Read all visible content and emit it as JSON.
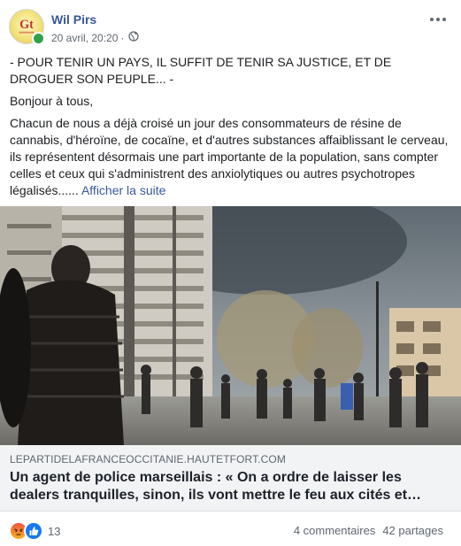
{
  "post": {
    "author": "Wil Pirs",
    "date": "20 avril, 20:20",
    "separator": "·",
    "privacy_icon": "globe-icon",
    "paragraphs": [
      "- POUR TENIR UN PAYS, IL SUFFIT DE TENIR SA JUSTICE, ET DE DROGUER SON PEUPLE... -",
      "Bonjour à tous,"
    ],
    "body_truncated": "Chacun de nous a déjà croisé un jour des consommateurs de résine de cannabis, d'héroïne, de cocaïne, et d'autres substances affaiblissant le cerveau, ils représentent désormais une part importante de la population, sans compter celles et ceux qui s'administrent des anxiolytiques ou autres psychotropes légalisés......",
    "see_more": "Afficher la suite"
  },
  "link": {
    "domain": "LEPARTIDELAFRANCEOCCITANIE.HAUTETFORT.COM",
    "headline": "Un agent de police marseillais : « On a ordre de laisser les dealers tranquilles, sinon, ils vont mettre le feu aux cités et…"
  },
  "footer": {
    "reaction_icons": [
      "angry-reaction-icon",
      "like-reaction-icon"
    ],
    "reaction_count": "13",
    "comments": "4 commentaires",
    "shares": "42 partages"
  },
  "colors": {
    "link_blue": "#385898",
    "secondary_text": "#606770",
    "preview_bg": "#f2f3f5",
    "online_green": "#31a24c"
  }
}
